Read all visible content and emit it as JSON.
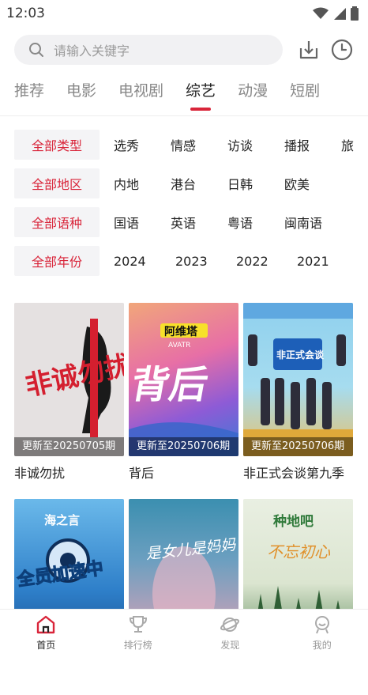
{
  "status_bar": {
    "time": "12:03"
  },
  "search": {
    "placeholder": "请输入关键字"
  },
  "tabs": [
    {
      "label": "推荐",
      "active": false
    },
    {
      "label": "电影",
      "active": false
    },
    {
      "label": "电视剧",
      "active": false
    },
    {
      "label": "综艺",
      "active": true
    },
    {
      "label": "动漫",
      "active": false
    },
    {
      "label": "短剧",
      "active": false
    }
  ],
  "filters": [
    {
      "label": "全部类型",
      "options": [
        "选秀",
        "情感",
        "访谈",
        "播报",
        "旅"
      ]
    },
    {
      "label": "全部地区",
      "options": [
        "内地",
        "港台",
        "日韩",
        "欧美"
      ]
    },
    {
      "label": "全部语种",
      "options": [
        "国语",
        "英语",
        "粤语",
        "闽南语"
      ]
    },
    {
      "label": "全部年份",
      "options": [
        "2024",
        "2023",
        "2022",
        "2021"
      ]
    }
  ],
  "cards": [
    {
      "title": "非诚勿扰",
      "badge": "更新至20250705期"
    },
    {
      "title": "背后",
      "badge": "更新至20250706期"
    },
    {
      "title": "非正式会谈第九季",
      "badge": "更新至20250706期"
    },
    {
      "title": "",
      "badge": ""
    },
    {
      "title": "",
      "badge": ""
    },
    {
      "title": "",
      "badge": ""
    }
  ],
  "posters": {
    "p1": {
      "logo_text": "非诚勿扰"
    },
    "p2": {
      "logo_text": "阿维塔",
      "sub_text": "AVATR",
      "main_text": "背后"
    },
    "p3": {
      "logo_text": "非正式会谈"
    },
    "p4": {
      "logo_text": "海之言",
      "main_text": "全员加速中"
    },
    "p5": {
      "main_text": "是女儿是妈妈"
    },
    "p6": {
      "logo_text": "种地吧",
      "main_text": "不忘初心"
    }
  },
  "nav": [
    {
      "label": "首页",
      "active": true
    },
    {
      "label": "排行榜",
      "active": false
    },
    {
      "label": "发现",
      "active": false
    },
    {
      "label": "我的",
      "active": false
    }
  ],
  "colors": {
    "accent": "#d9253a",
    "chip_bg": "#f4f4f6"
  }
}
